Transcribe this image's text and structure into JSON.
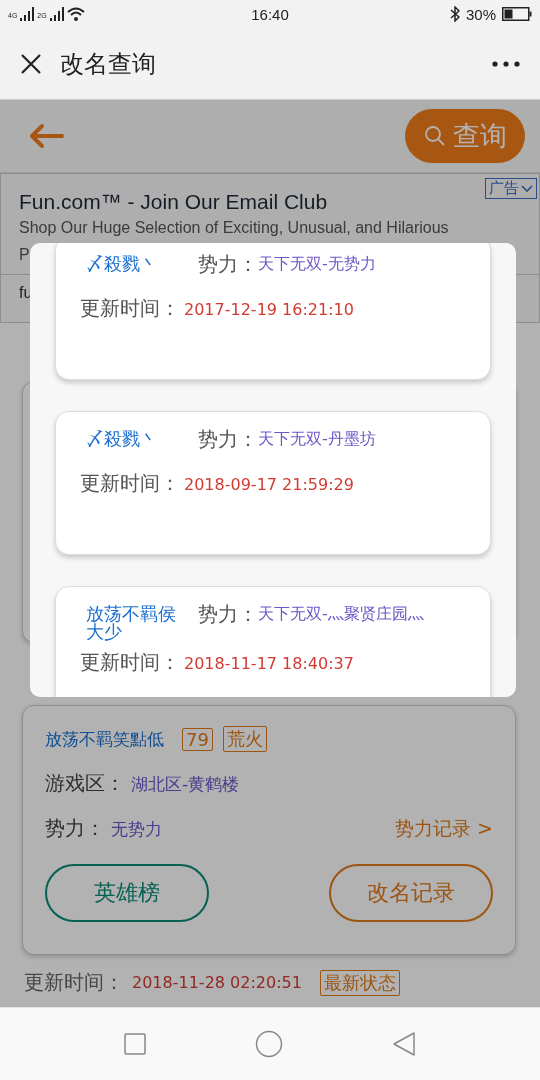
{
  "status_bar": {
    "time": "16:40",
    "battery": "30%",
    "network_1": "4G",
    "network_2": "2G"
  },
  "title_bar": {
    "title": "改名查询"
  },
  "toolbar": {
    "search_button": "查询"
  },
  "ad": {
    "title": "Fun.com™ - Join Our Email Club",
    "badge": "广告",
    "description_lines": [
      "Shop Our Huge Selection of Exciting, Unusual, and Hilarious",
      "P"
    ],
    "link_text": "fu"
  },
  "result_card": {
    "name": "放荡不羁笑點低",
    "level": "79",
    "server_tag": "荒火",
    "zone_label": "游戏区：",
    "zone": "湖北区-黄鹤楼",
    "faction_label": "势力：",
    "faction": "无势力",
    "faction_link": "势力记录 >",
    "buttons": [
      "英雄榜",
      "改名记录"
    ]
  },
  "update_row": {
    "label": "更新时间：",
    "time": "2018-11-28 02:20:51",
    "tag": "最新状态"
  },
  "dialog": {
    "records": [
      {
        "name": "〆殺戮丶",
        "faction_label": "势力：",
        "faction": "天下无双-无势力",
        "time_label": "更新时间：",
        "time": "2017-12-19 16:21:10"
      },
      {
        "name": "〆殺戮丶",
        "faction_label": "势力：",
        "faction": "天下无双-丹墨坊",
        "time_label": "更新时间：",
        "time": "2018-09-17 21:59:29"
      },
      {
        "name": "放荡不羁侯大少",
        "faction_label": "势力：",
        "faction": "天下无双-灬聚贤庄园灬",
        "time_label": "更新时间：",
        "time": "2018-11-17 18:40:37"
      }
    ]
  }
}
